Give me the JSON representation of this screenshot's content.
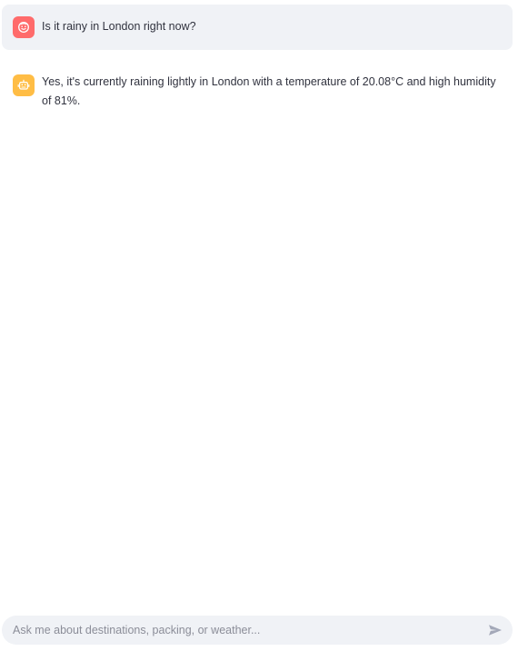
{
  "messages": [
    {
      "role": "user",
      "avatar_icon": "user-face-icon",
      "avatar_color": "#ff6b6b",
      "text": "Is it rainy in London right now?"
    },
    {
      "role": "assistant",
      "avatar_icon": "robot-icon",
      "avatar_color": "#ffbd45",
      "text": "Yes, it's currently raining lightly in London with a temperature of 20.08°C and high humidity of 81%."
    }
  ],
  "chat_input": {
    "placeholder": "Ask me about destinations, packing, or weather...",
    "value": "",
    "send_icon": "send-arrow-icon"
  },
  "colors": {
    "user_bubble_bg": "#f0f2f6",
    "input_bg": "#f0f2f6",
    "text": "#31333f",
    "placeholder": "#8b8d98",
    "send_icon": "#a3a8b8"
  }
}
